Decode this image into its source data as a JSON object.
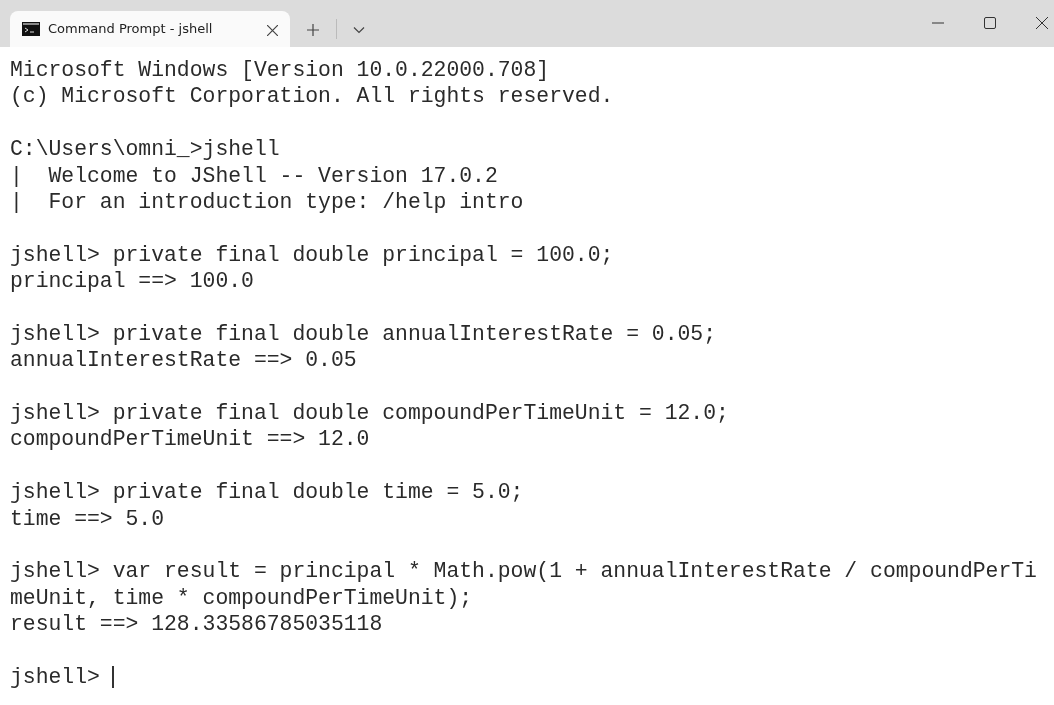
{
  "tabs": [
    {
      "title": "Command Prompt - jshell",
      "selected": true
    }
  ],
  "terminal": {
    "blocks": [
      [
        "Microsoft Windows [Version 10.0.22000.708]",
        "(c) Microsoft Corporation. All rights reserved."
      ],
      [
        "C:\\Users\\omni_>jshell",
        "|  Welcome to JShell -- Version 17.0.2",
        "|  For an introduction type: /help intro"
      ],
      [
        "jshell> private final double principal = 100.0;",
        "principal ==> 100.0"
      ],
      [
        "jshell> private final double annualInterestRate = 0.05;",
        "annualInterestRate ==> 0.05"
      ],
      [
        "jshell> private final double compoundPerTimeUnit = 12.0;",
        "compoundPerTimeUnit ==> 12.0"
      ],
      [
        "jshell> private final double time = 5.0;",
        "time ==> 5.0"
      ],
      [
        "jshell> var result = principal * Math.pow(1 + annualInterestRate / compoundPerTi",
        "meUnit, time * compoundPerTimeUnit);",
        "result ==> 128.33586785035118"
      ]
    ],
    "prompt": "jshell>"
  }
}
